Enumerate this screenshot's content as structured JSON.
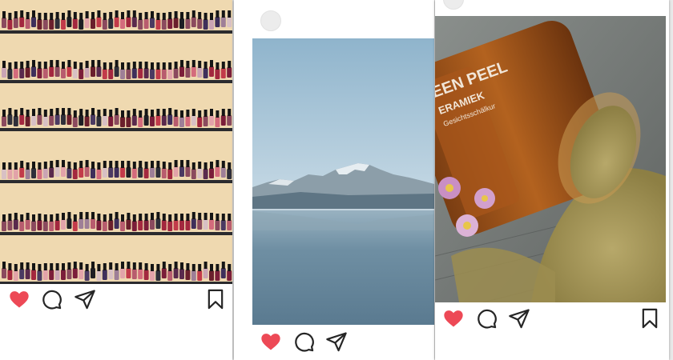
{
  "feed": {
    "posts": [
      {
        "photo_subject": "nail-polish-shelves",
        "liked": true,
        "icons": [
          "heart-icon",
          "comment-icon",
          "share-icon",
          "bookmark-icon"
        ]
      },
      {
        "photo_subject": "mountain-lake",
        "liked": true,
        "icons": [
          "heart-icon",
          "comment-icon",
          "share-icon"
        ]
      },
      {
        "photo_subject": "spilled-jar",
        "jar_label": [
          "EEN PEEL",
          "ERAMIEK",
          "Gesichtsschälkur"
        ],
        "liked": true,
        "icons": [
          "heart-icon",
          "comment-icon",
          "share-icon",
          "bookmark-icon"
        ]
      }
    ]
  },
  "colors": {
    "like_red": "#ed4956",
    "icon_dark": "#262626",
    "card_bg": "#ffffff",
    "page_bg": "#e9e9e9"
  }
}
